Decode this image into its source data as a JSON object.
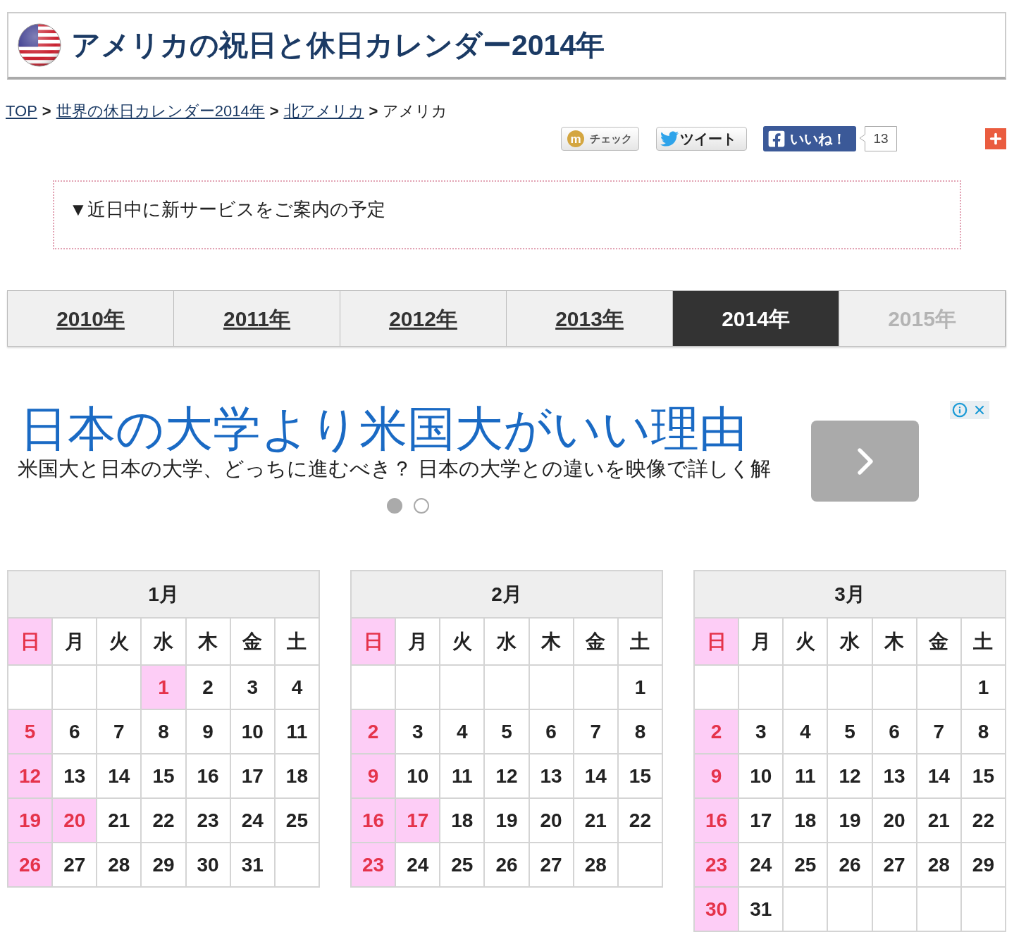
{
  "header": {
    "title": "アメリカの祝日と休日カレンダー2014年"
  },
  "breadcrumb": {
    "items": [
      {
        "label": "TOP",
        "link": true
      },
      {
        "label": "世界の休日カレンダー2014年",
        "link": true
      },
      {
        "label": "北アメリカ",
        "link": true
      },
      {
        "label": "アメリカ",
        "link": false
      }
    ],
    "separators": [
      ">",
      ">",
      ">"
    ]
  },
  "social": {
    "check": {
      "icon": "m",
      "label": "チェック"
    },
    "tweet": {
      "label": "ツイート"
    },
    "like": {
      "label": "いいね！",
      "count": "13"
    }
  },
  "notice": {
    "text": "▼近日中に新サービスをご案内の予定"
  },
  "year_tabs": [
    {
      "label": "2010年",
      "selected": false,
      "disabled": false
    },
    {
      "label": "2011年",
      "selected": false,
      "disabled": false
    },
    {
      "label": "2012年",
      "selected": false,
      "disabled": false
    },
    {
      "label": "2013年",
      "selected": false,
      "disabled": false
    },
    {
      "label": "2014年",
      "selected": true,
      "disabled": false
    },
    {
      "label": "2015年",
      "selected": false,
      "disabled": true
    }
  ],
  "ad": {
    "headline": "日本の大学より米国大がいい理由",
    "description": "米国大と日本の大学、どっちに進むべき？ 日本の大学との違いを映像で詳しく解",
    "dots": [
      {
        "selected": true
      },
      {
        "selected": false
      }
    ]
  },
  "calendars": [
    {
      "month": "1月",
      "weekdays": [
        {
          "label": "日",
          "holiday": true
        },
        {
          "label": "月",
          "holiday": false
        },
        {
          "label": "火",
          "holiday": false
        },
        {
          "label": "水",
          "holiday": false
        },
        {
          "label": "木",
          "holiday": false
        },
        {
          "label": "金",
          "holiday": false
        },
        {
          "label": "土",
          "holiday": false
        }
      ],
      "weeks": [
        [
          {
            "kind": "blank"
          },
          {
            "kind": "blank"
          },
          {
            "kind": "blank"
          },
          {
            "kind": "date",
            "day": "1",
            "holiday": true
          },
          {
            "kind": "date",
            "day": "2",
            "holiday": false
          },
          {
            "kind": "date",
            "day": "3",
            "holiday": false
          },
          {
            "kind": "date",
            "day": "4",
            "holiday": false
          }
        ],
        [
          {
            "kind": "date",
            "day": "5",
            "holiday": true
          },
          {
            "kind": "date",
            "day": "6",
            "holiday": false
          },
          {
            "kind": "date",
            "day": "7",
            "holiday": false
          },
          {
            "kind": "date",
            "day": "8",
            "holiday": false
          },
          {
            "kind": "date",
            "day": "9",
            "holiday": false
          },
          {
            "kind": "date",
            "day": "10",
            "holiday": false
          },
          {
            "kind": "date",
            "day": "11",
            "holiday": false
          }
        ],
        [
          {
            "kind": "date",
            "day": "12",
            "holiday": true
          },
          {
            "kind": "date",
            "day": "13",
            "holiday": false
          },
          {
            "kind": "date",
            "day": "14",
            "holiday": false
          },
          {
            "kind": "date",
            "day": "15",
            "holiday": false
          },
          {
            "kind": "date",
            "day": "16",
            "holiday": false
          },
          {
            "kind": "date",
            "day": "17",
            "holiday": false
          },
          {
            "kind": "date",
            "day": "18",
            "holiday": false
          }
        ],
        [
          {
            "kind": "date",
            "day": "19",
            "holiday": true
          },
          {
            "kind": "date",
            "day": "20",
            "holiday": true
          },
          {
            "kind": "date",
            "day": "21",
            "holiday": false
          },
          {
            "kind": "date",
            "day": "22",
            "holiday": false
          },
          {
            "kind": "date",
            "day": "23",
            "holiday": false
          },
          {
            "kind": "date",
            "day": "24",
            "holiday": false
          },
          {
            "kind": "date",
            "day": "25",
            "holiday": false
          }
        ],
        [
          {
            "kind": "date",
            "day": "26",
            "holiday": true
          },
          {
            "kind": "date",
            "day": "27",
            "holiday": false
          },
          {
            "kind": "date",
            "day": "28",
            "holiday": false
          },
          {
            "kind": "date",
            "day": "29",
            "holiday": false
          },
          {
            "kind": "date",
            "day": "30",
            "holiday": false
          },
          {
            "kind": "date",
            "day": "31",
            "holiday": false
          },
          {
            "kind": "blank"
          }
        ]
      ]
    },
    {
      "month": "2月",
      "weekdays": [
        {
          "label": "日",
          "holiday": true
        },
        {
          "label": "月",
          "holiday": false
        },
        {
          "label": "火",
          "holiday": false
        },
        {
          "label": "水",
          "holiday": false
        },
        {
          "label": "木",
          "holiday": false
        },
        {
          "label": "金",
          "holiday": false
        },
        {
          "label": "土",
          "holiday": false
        }
      ],
      "weeks": [
        [
          {
            "kind": "blank"
          },
          {
            "kind": "blank"
          },
          {
            "kind": "blank"
          },
          {
            "kind": "blank"
          },
          {
            "kind": "blank"
          },
          {
            "kind": "blank"
          },
          {
            "kind": "date",
            "day": "1",
            "holiday": false
          }
        ],
        [
          {
            "kind": "date",
            "day": "2",
            "holiday": true
          },
          {
            "kind": "date",
            "day": "3",
            "holiday": false
          },
          {
            "kind": "date",
            "day": "4",
            "holiday": false
          },
          {
            "kind": "date",
            "day": "5",
            "holiday": false
          },
          {
            "kind": "date",
            "day": "6",
            "holiday": false
          },
          {
            "kind": "date",
            "day": "7",
            "holiday": false
          },
          {
            "kind": "date",
            "day": "8",
            "holiday": false
          }
        ],
        [
          {
            "kind": "date",
            "day": "9",
            "holiday": true
          },
          {
            "kind": "date",
            "day": "10",
            "holiday": false
          },
          {
            "kind": "date",
            "day": "11",
            "holiday": false
          },
          {
            "kind": "date",
            "day": "12",
            "holiday": false
          },
          {
            "kind": "date",
            "day": "13",
            "holiday": false
          },
          {
            "kind": "date",
            "day": "14",
            "holiday": false
          },
          {
            "kind": "date",
            "day": "15",
            "holiday": false
          }
        ],
        [
          {
            "kind": "date",
            "day": "16",
            "holiday": true
          },
          {
            "kind": "date",
            "day": "17",
            "holiday": true
          },
          {
            "kind": "date",
            "day": "18",
            "holiday": false
          },
          {
            "kind": "date",
            "day": "19",
            "holiday": false
          },
          {
            "kind": "date",
            "day": "20",
            "holiday": false
          },
          {
            "kind": "date",
            "day": "21",
            "holiday": false
          },
          {
            "kind": "date",
            "day": "22",
            "holiday": false
          }
        ],
        [
          {
            "kind": "date",
            "day": "23",
            "holiday": true
          },
          {
            "kind": "date",
            "day": "24",
            "holiday": false
          },
          {
            "kind": "date",
            "day": "25",
            "holiday": false
          },
          {
            "kind": "date",
            "day": "26",
            "holiday": false
          },
          {
            "kind": "date",
            "day": "27",
            "holiday": false
          },
          {
            "kind": "date",
            "day": "28",
            "holiday": false
          },
          {
            "kind": "blank"
          }
        ]
      ]
    },
    {
      "month": "3月",
      "weekdays": [
        {
          "label": "日",
          "holiday": true
        },
        {
          "label": "月",
          "holiday": false
        },
        {
          "label": "火",
          "holiday": false
        },
        {
          "label": "水",
          "holiday": false
        },
        {
          "label": "木",
          "holiday": false
        },
        {
          "label": "金",
          "holiday": false
        },
        {
          "label": "土",
          "holiday": false
        }
      ],
      "weeks": [
        [
          {
            "kind": "blank"
          },
          {
            "kind": "blank"
          },
          {
            "kind": "blank"
          },
          {
            "kind": "blank"
          },
          {
            "kind": "blank"
          },
          {
            "kind": "blank"
          },
          {
            "kind": "date",
            "day": "1",
            "holiday": false
          }
        ],
        [
          {
            "kind": "date",
            "day": "2",
            "holiday": true
          },
          {
            "kind": "date",
            "day": "3",
            "holiday": false
          },
          {
            "kind": "date",
            "day": "4",
            "holiday": false
          },
          {
            "kind": "date",
            "day": "5",
            "holiday": false
          },
          {
            "kind": "date",
            "day": "6",
            "holiday": false
          },
          {
            "kind": "date",
            "day": "7",
            "holiday": false
          },
          {
            "kind": "date",
            "day": "8",
            "holiday": false
          }
        ],
        [
          {
            "kind": "date",
            "day": "9",
            "holiday": true
          },
          {
            "kind": "date",
            "day": "10",
            "holiday": false
          },
          {
            "kind": "date",
            "day": "11",
            "holiday": false
          },
          {
            "kind": "date",
            "day": "12",
            "holiday": false
          },
          {
            "kind": "date",
            "day": "13",
            "holiday": false
          },
          {
            "kind": "date",
            "day": "14",
            "holiday": false
          },
          {
            "kind": "date",
            "day": "15",
            "holiday": false
          }
        ],
        [
          {
            "kind": "date",
            "day": "16",
            "holiday": true
          },
          {
            "kind": "date",
            "day": "17",
            "holiday": false
          },
          {
            "kind": "date",
            "day": "18",
            "holiday": false
          },
          {
            "kind": "date",
            "day": "19",
            "holiday": false
          },
          {
            "kind": "date",
            "day": "20",
            "holiday": false
          },
          {
            "kind": "date",
            "day": "21",
            "holiday": false
          },
          {
            "kind": "date",
            "day": "22",
            "holiday": false
          }
        ],
        [
          {
            "kind": "date",
            "day": "23",
            "holiday": true
          },
          {
            "kind": "date",
            "day": "24",
            "holiday": false
          },
          {
            "kind": "date",
            "day": "25",
            "holiday": false
          },
          {
            "kind": "date",
            "day": "26",
            "holiday": false
          },
          {
            "kind": "date",
            "day": "27",
            "holiday": false
          },
          {
            "kind": "date",
            "day": "28",
            "holiday": false
          },
          {
            "kind": "date",
            "day": "29",
            "holiday": false
          }
        ],
        [
          {
            "kind": "date",
            "day": "30",
            "holiday": true
          },
          {
            "kind": "date",
            "day": "31",
            "holiday": false
          },
          {
            "kind": "blank"
          },
          {
            "kind": "blank"
          },
          {
            "kind": "blank"
          },
          {
            "kind": "blank"
          },
          {
            "kind": "blank"
          }
        ]
      ]
    }
  ]
}
